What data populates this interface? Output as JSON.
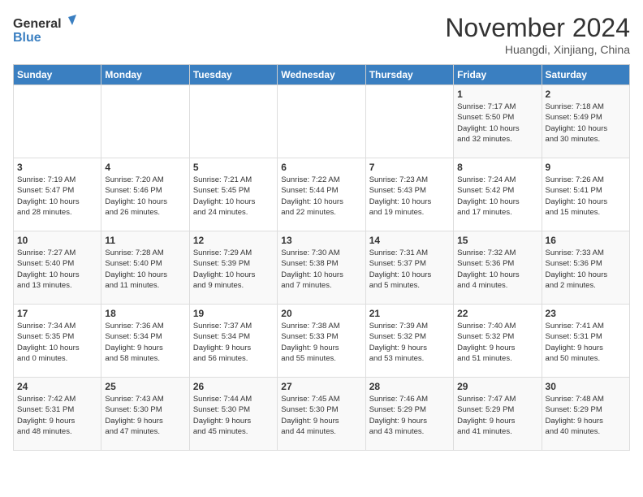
{
  "header": {
    "logo_line1": "General",
    "logo_line2": "Blue",
    "month": "November 2024",
    "location": "Huangdi, Xinjiang, China"
  },
  "days_of_week": [
    "Sunday",
    "Monday",
    "Tuesday",
    "Wednesday",
    "Thursday",
    "Friday",
    "Saturday"
  ],
  "weeks": [
    [
      {
        "day": "",
        "info": ""
      },
      {
        "day": "",
        "info": ""
      },
      {
        "day": "",
        "info": ""
      },
      {
        "day": "",
        "info": ""
      },
      {
        "day": "",
        "info": ""
      },
      {
        "day": "1",
        "info": "Sunrise: 7:17 AM\nSunset: 5:50 PM\nDaylight: 10 hours\nand 32 minutes."
      },
      {
        "day": "2",
        "info": "Sunrise: 7:18 AM\nSunset: 5:49 PM\nDaylight: 10 hours\nand 30 minutes."
      }
    ],
    [
      {
        "day": "3",
        "info": "Sunrise: 7:19 AM\nSunset: 5:47 PM\nDaylight: 10 hours\nand 28 minutes."
      },
      {
        "day": "4",
        "info": "Sunrise: 7:20 AM\nSunset: 5:46 PM\nDaylight: 10 hours\nand 26 minutes."
      },
      {
        "day": "5",
        "info": "Sunrise: 7:21 AM\nSunset: 5:45 PM\nDaylight: 10 hours\nand 24 minutes."
      },
      {
        "day": "6",
        "info": "Sunrise: 7:22 AM\nSunset: 5:44 PM\nDaylight: 10 hours\nand 22 minutes."
      },
      {
        "day": "7",
        "info": "Sunrise: 7:23 AM\nSunset: 5:43 PM\nDaylight: 10 hours\nand 19 minutes."
      },
      {
        "day": "8",
        "info": "Sunrise: 7:24 AM\nSunset: 5:42 PM\nDaylight: 10 hours\nand 17 minutes."
      },
      {
        "day": "9",
        "info": "Sunrise: 7:26 AM\nSunset: 5:41 PM\nDaylight: 10 hours\nand 15 minutes."
      }
    ],
    [
      {
        "day": "10",
        "info": "Sunrise: 7:27 AM\nSunset: 5:40 PM\nDaylight: 10 hours\nand 13 minutes."
      },
      {
        "day": "11",
        "info": "Sunrise: 7:28 AM\nSunset: 5:40 PM\nDaylight: 10 hours\nand 11 minutes."
      },
      {
        "day": "12",
        "info": "Sunrise: 7:29 AM\nSunset: 5:39 PM\nDaylight: 10 hours\nand 9 minutes."
      },
      {
        "day": "13",
        "info": "Sunrise: 7:30 AM\nSunset: 5:38 PM\nDaylight: 10 hours\nand 7 minutes."
      },
      {
        "day": "14",
        "info": "Sunrise: 7:31 AM\nSunset: 5:37 PM\nDaylight: 10 hours\nand 5 minutes."
      },
      {
        "day": "15",
        "info": "Sunrise: 7:32 AM\nSunset: 5:36 PM\nDaylight: 10 hours\nand 4 minutes."
      },
      {
        "day": "16",
        "info": "Sunrise: 7:33 AM\nSunset: 5:36 PM\nDaylight: 10 hours\nand 2 minutes."
      }
    ],
    [
      {
        "day": "17",
        "info": "Sunrise: 7:34 AM\nSunset: 5:35 PM\nDaylight: 10 hours\nand 0 minutes."
      },
      {
        "day": "18",
        "info": "Sunrise: 7:36 AM\nSunset: 5:34 PM\nDaylight: 9 hours\nand 58 minutes."
      },
      {
        "day": "19",
        "info": "Sunrise: 7:37 AM\nSunset: 5:34 PM\nDaylight: 9 hours\nand 56 minutes."
      },
      {
        "day": "20",
        "info": "Sunrise: 7:38 AM\nSunset: 5:33 PM\nDaylight: 9 hours\nand 55 minutes."
      },
      {
        "day": "21",
        "info": "Sunrise: 7:39 AM\nSunset: 5:32 PM\nDaylight: 9 hours\nand 53 minutes."
      },
      {
        "day": "22",
        "info": "Sunrise: 7:40 AM\nSunset: 5:32 PM\nDaylight: 9 hours\nand 51 minutes."
      },
      {
        "day": "23",
        "info": "Sunrise: 7:41 AM\nSunset: 5:31 PM\nDaylight: 9 hours\nand 50 minutes."
      }
    ],
    [
      {
        "day": "24",
        "info": "Sunrise: 7:42 AM\nSunset: 5:31 PM\nDaylight: 9 hours\nand 48 minutes."
      },
      {
        "day": "25",
        "info": "Sunrise: 7:43 AM\nSunset: 5:30 PM\nDaylight: 9 hours\nand 47 minutes."
      },
      {
        "day": "26",
        "info": "Sunrise: 7:44 AM\nSunset: 5:30 PM\nDaylight: 9 hours\nand 45 minutes."
      },
      {
        "day": "27",
        "info": "Sunrise: 7:45 AM\nSunset: 5:30 PM\nDaylight: 9 hours\nand 44 minutes."
      },
      {
        "day": "28",
        "info": "Sunrise: 7:46 AM\nSunset: 5:29 PM\nDaylight: 9 hours\nand 43 minutes."
      },
      {
        "day": "29",
        "info": "Sunrise: 7:47 AM\nSunset: 5:29 PM\nDaylight: 9 hours\nand 41 minutes."
      },
      {
        "day": "30",
        "info": "Sunrise: 7:48 AM\nSunset: 5:29 PM\nDaylight: 9 hours\nand 40 minutes."
      }
    ]
  ]
}
